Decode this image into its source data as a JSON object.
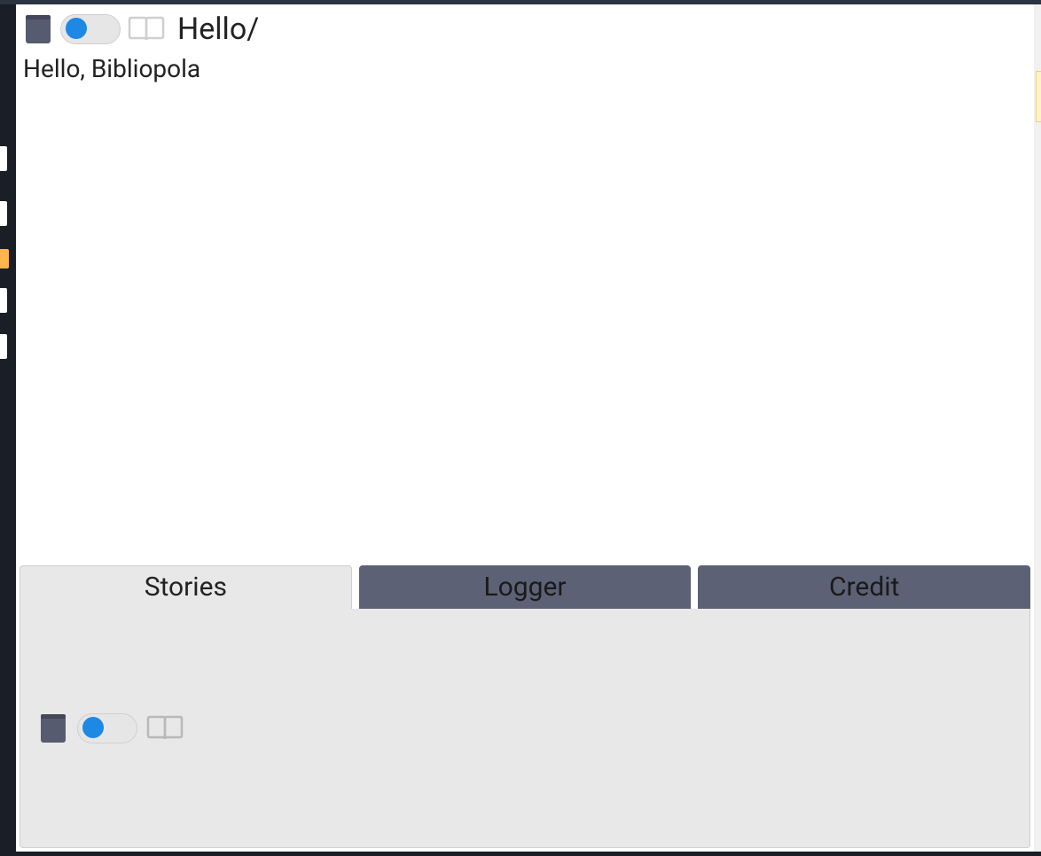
{
  "header": {
    "breadcrumb": "Hello/",
    "subtitle": "Hello, Bibliopola"
  },
  "tabs": [
    {
      "label": "Stories",
      "active": true
    },
    {
      "label": "Logger",
      "active": false
    },
    {
      "label": "Credit",
      "active": false
    }
  ],
  "colors": {
    "dark_bg": "#1a1e26",
    "panel_bg": "#e8e8e8",
    "inactive_tab": "#5d6175",
    "toggle_knob": "#1e88e5",
    "book_closed": "#575b70",
    "book_open": "#cfcfcf"
  }
}
